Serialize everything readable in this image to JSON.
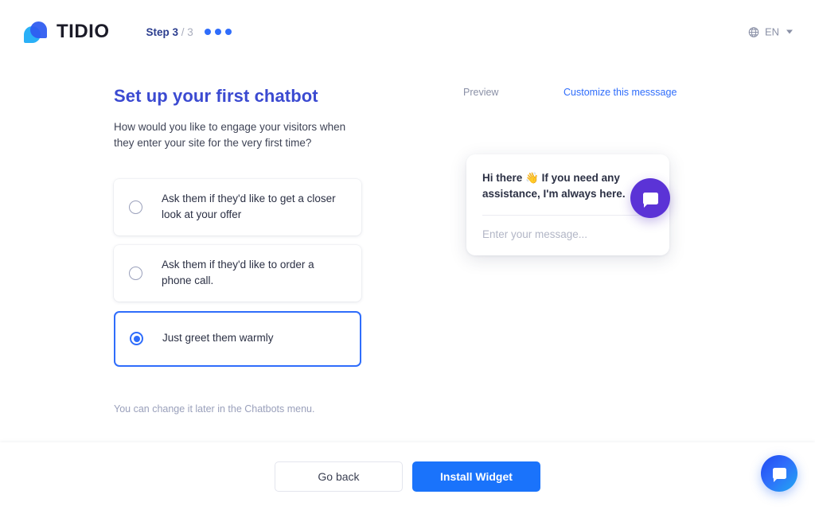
{
  "header": {
    "brand_name": "TIDIO",
    "logo_icon": "tidio-logo-icon",
    "step_label": "Step 3",
    "step_total": "/ 3",
    "step_dots": 3,
    "language": {
      "icon": "globe-icon",
      "value": "EN",
      "chevron": "chevron-down-icon"
    }
  },
  "main": {
    "title": "Set up your first chatbot",
    "subtitle": "How would you like to engage your visitors when they enter your site for the very first time?",
    "options": [
      {
        "label": "Ask them if they'd like to get a closer look at your offer",
        "selected": false
      },
      {
        "label": "Ask them if they'd like to order a phone call.",
        "selected": false
      },
      {
        "label": "Just greet them warmly",
        "selected": true
      }
    ],
    "hint": "You can change it later in the Chatbots menu."
  },
  "preview": {
    "label": "Preview",
    "customize_link": "Customize this messsage",
    "chat": {
      "message": "Hi there 👋 If you need any assistance, I'm always here.",
      "input_placeholder": "Enter your message...",
      "bubble_icon": "chat-bubble-icon"
    }
  },
  "footer": {
    "back_label": "Go back",
    "install_label": "Install Widget"
  },
  "floating_widget": {
    "icon": "chat-bubble-icon"
  },
  "colors": {
    "accent_blue": "#2f6dfb",
    "primary_button": "#1a73fb",
    "title_blue": "#3b4ad1",
    "widget_purple": "#5b33d6",
    "muted_text": "#8a90a6"
  }
}
